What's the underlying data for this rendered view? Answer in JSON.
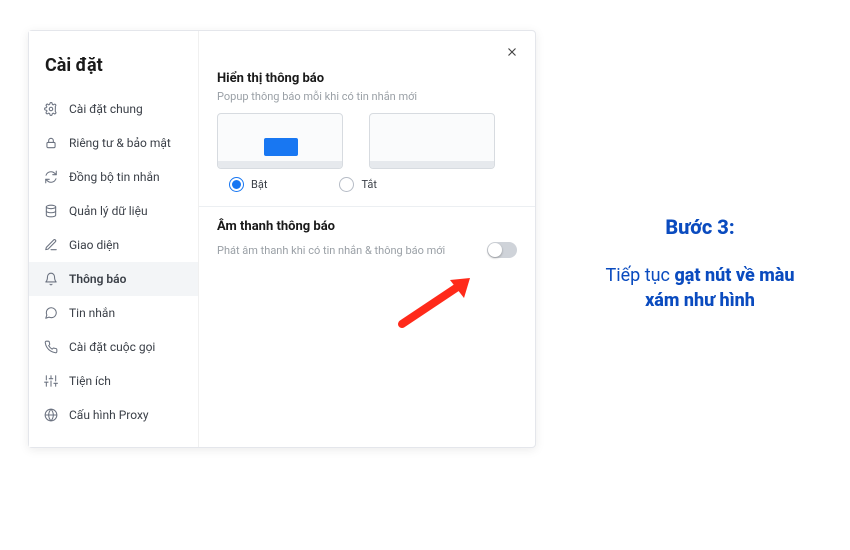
{
  "sidebar": {
    "title": "Cài đặt",
    "items": [
      {
        "label": "Cài đặt chung"
      },
      {
        "label": "Riêng tư & bảo mật"
      },
      {
        "label": "Đồng bộ tin nhắn"
      },
      {
        "label": "Quản lý dữ liệu"
      },
      {
        "label": "Giao diện"
      },
      {
        "label": "Thông báo",
        "active": true
      },
      {
        "label": "Tin nhắn"
      },
      {
        "label": "Cài đặt cuộc gọi"
      },
      {
        "label": "Tiện ích"
      },
      {
        "label": "Cấu hình Proxy"
      }
    ]
  },
  "content": {
    "show_notif": {
      "title": "Hiển thị thông báo",
      "desc": "Popup thông báo mỗi khi có tin nhắn mới",
      "opt_on": "Bật",
      "opt_off": "Tắt",
      "selected": "on"
    },
    "sound": {
      "title": "Âm thanh thông báo",
      "desc": "Phát âm thanh khi có tin nhắn & thông báo mới",
      "enabled": false
    }
  },
  "instruction": {
    "step_label": "Bước 3:",
    "line1_prefix": "Tiếp tục ",
    "line1_bold": "gạt nút về màu",
    "line2_bold": "xám như hình"
  }
}
